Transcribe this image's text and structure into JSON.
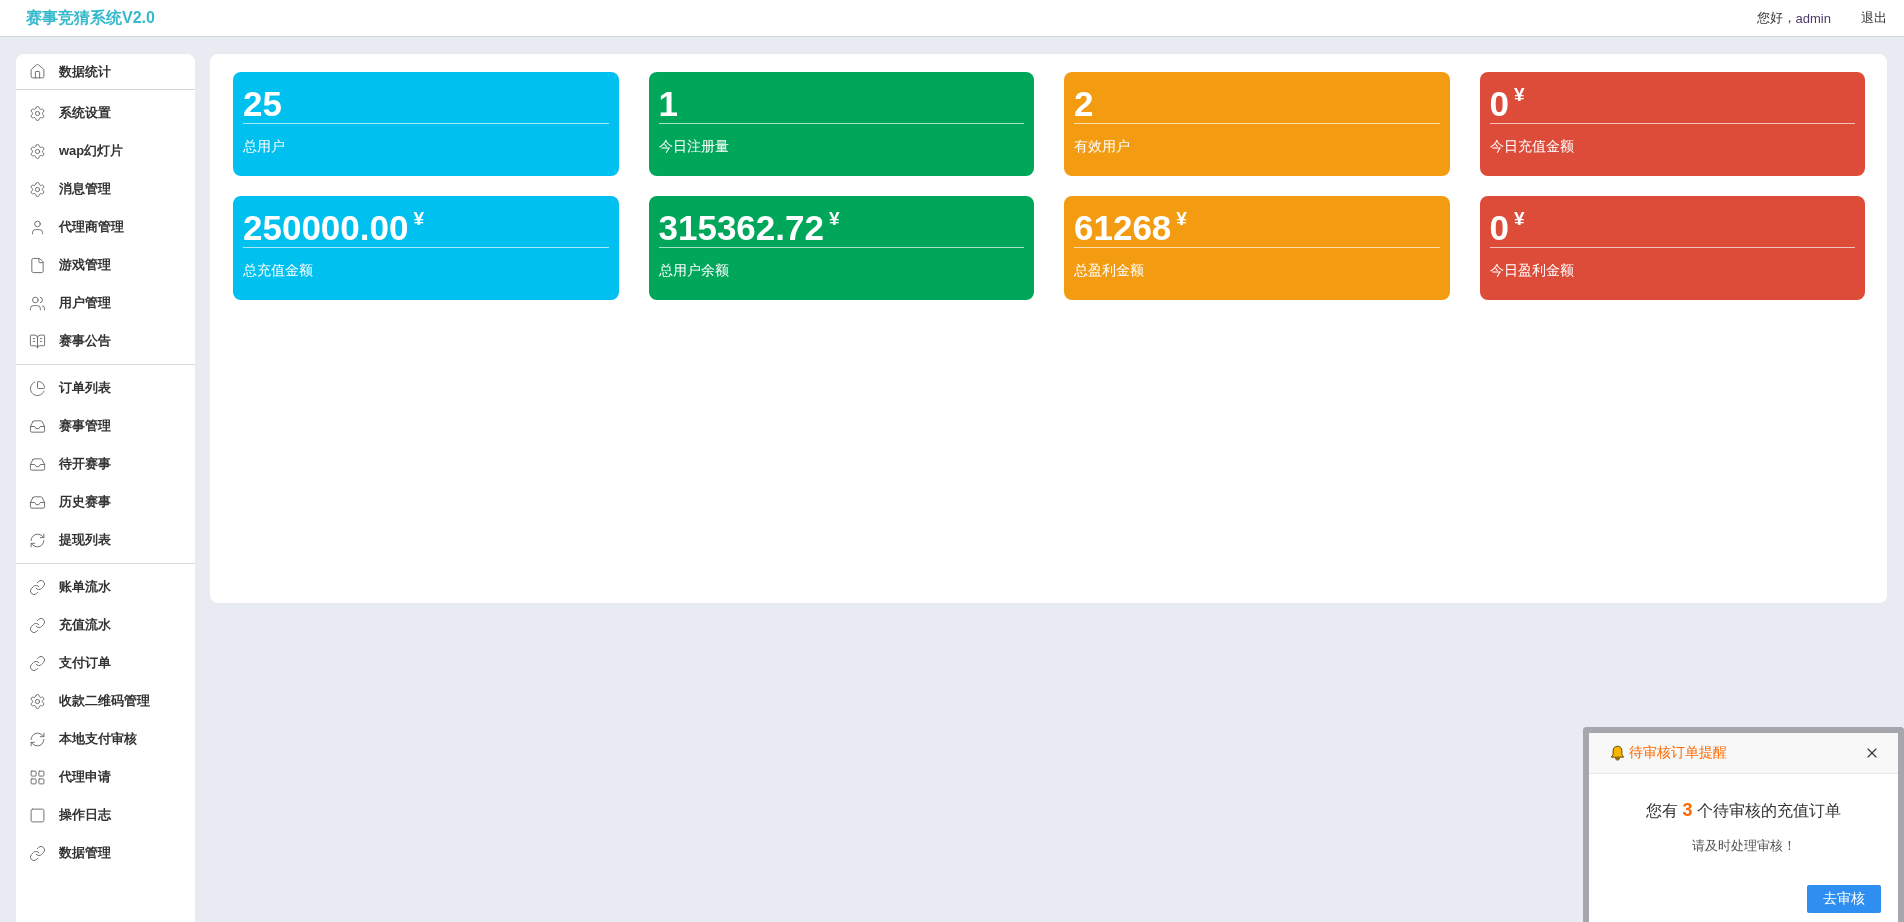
{
  "header": {
    "title": "赛事竞猜系统V2.0",
    "greeting": "您好，",
    "username": "admin",
    "logout": "退出"
  },
  "sidebar": {
    "groups": [
      {
        "items": [
          {
            "label": "数据统计"
          }
        ]
      },
      {
        "items": [
          {
            "label": "系统设置"
          },
          {
            "label": "wap幻灯片"
          },
          {
            "label": "消息管理"
          },
          {
            "label": "代理商管理"
          },
          {
            "label": "游戏管理"
          },
          {
            "label": "用户管理"
          },
          {
            "label": "赛事公告"
          }
        ]
      },
      {
        "items": [
          {
            "label": "订单列表"
          },
          {
            "label": "赛事管理"
          },
          {
            "label": "待开赛事"
          },
          {
            "label": "历史赛事"
          },
          {
            "label": "提现列表"
          }
        ]
      },
      {
        "items": [
          {
            "label": "账单流水"
          },
          {
            "label": "充值流水"
          },
          {
            "label": "支付订单"
          },
          {
            "label": "收款二维码管理"
          },
          {
            "label": "本地支付审核"
          },
          {
            "label": "代理申请"
          },
          {
            "label": "操作日志"
          },
          {
            "label": "数据管理"
          }
        ]
      }
    ]
  },
  "stats": {
    "cards": [
      {
        "value": "25",
        "label": "总用户",
        "color": "#00c0ef"
      },
      {
        "value": "1",
        "label": "今日注册量",
        "color": "#00a65a"
      },
      {
        "value": "2",
        "label": "有效用户",
        "color": "#f39c12"
      },
      {
        "value": "0",
        "unit": "¥",
        "label": "今日充值金额",
        "color": "#dd4b39"
      },
      {
        "value": "250000.00",
        "unit": "¥",
        "label": "总充值金额",
        "color": "#00c0ef"
      },
      {
        "value": "315362.72",
        "unit": "¥",
        "label": "总用户余额",
        "color": "#00a65a"
      },
      {
        "value": "61268",
        "unit": "¥",
        "label": "总盈利金额",
        "color": "#f39c12"
      },
      {
        "value": "0",
        "unit": "¥",
        "label": "今日盈利金额",
        "color": "#dd4b39"
      }
    ]
  },
  "notification": {
    "title": "待审核订单提醒",
    "message": "您有 **3** 个待审核的充值订单",
    "note": "请及时处理审核！",
    "button": "去审核"
  }
}
